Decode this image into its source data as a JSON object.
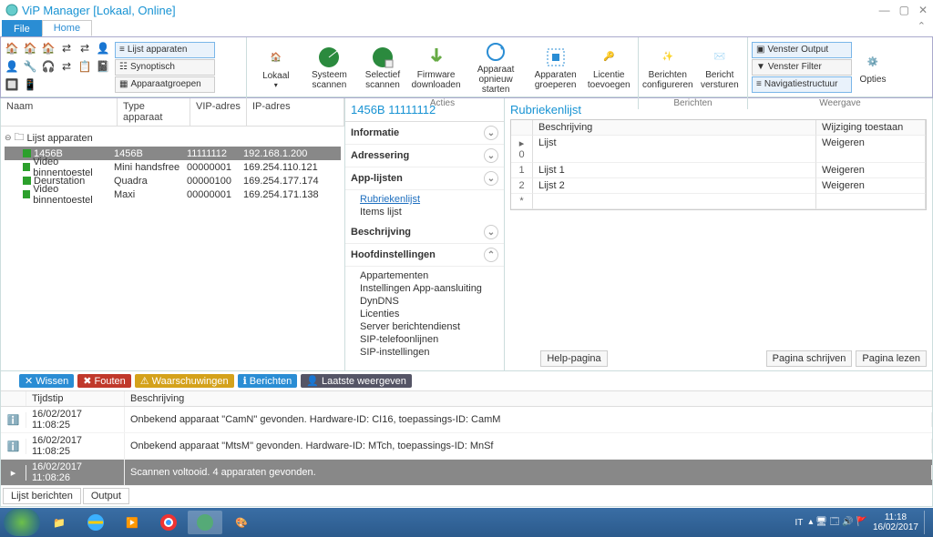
{
  "window": {
    "title": "ViP Manager [Lokaal, Online]"
  },
  "tabs": {
    "file": "File",
    "home": "Home"
  },
  "ribbon": {
    "list_group": {
      "list": "Lijst apparaten",
      "synoptisch": "Synoptisch",
      "groepen": "Apparaatgroepen"
    },
    "labels": {
      "nav": "Navigatiestructuur",
      "acties": "Acties",
      "berichten": "Berichten",
      "weergave": "Weergave"
    },
    "actions": {
      "lokaal": "Lokaal",
      "systeem": "Systeem\nscannen",
      "selectief": "Selectief\nscannen",
      "firmware": "Firmware\ndownloaden",
      "restart": "Apparaat\nopnieuw starten",
      "groep": "Apparaten\ngroeperen",
      "licentie": "Licentie\ntoevoegen"
    },
    "berichten": {
      "config": "Berichten\nconfigureren",
      "verst": "Bericht\nversturen"
    },
    "view": {
      "output": "Venster Output",
      "filter": "Venster Filter",
      "nav": "Navigatiestructuur",
      "opties": "Opties"
    }
  },
  "tree": {
    "cols": {
      "naam": "Naam",
      "type": "Type apparaat",
      "vip": "VIP-adres",
      "ip": "IP-adres"
    },
    "root": "Lijst apparaten",
    "rows": [
      {
        "naam": "1456B",
        "type": "1456B",
        "vip": "11111112",
        "ip": "192.168.1.200",
        "sel": true
      },
      {
        "naam": "Video binnentoestel",
        "type": "Mini handsfree",
        "vip": "00000001",
        "ip": "169.254.110.121"
      },
      {
        "naam": "Deurstation",
        "type": "Quadra",
        "vip": "00000100",
        "ip": "169.254.177.174"
      },
      {
        "naam": "Video binnentoestel",
        "type": "Maxi",
        "vip": "00000001",
        "ip": "169.254.171.138"
      }
    ]
  },
  "mid": {
    "title": "1456B 11111112",
    "sections": {
      "info": "Informatie",
      "addr": "Adressering",
      "app": "App-lijsten",
      "besch": "Beschrijving",
      "hoofd": "Hoofdinstellingen"
    },
    "app_items": {
      "rubriek": "Rubriekenlijst",
      "items": "Items lijst"
    },
    "hoofd_items": [
      "Appartementen",
      "Instellingen App-aansluiting",
      "DynDNS",
      "Licenties",
      "Server berichtendienst",
      "SIP-telefoonlijnen",
      "SIP-instellingen"
    ]
  },
  "right": {
    "title": "Rubriekenlijst",
    "head": {
      "besch": "Beschrijving",
      "wijz": "Wijziging toestaan"
    },
    "rows": [
      {
        "idx": "▸ 0",
        "b": "Lijst",
        "w": "Weigeren"
      },
      {
        "idx": "1",
        "b": "Lijst 1",
        "w": "Weigeren"
      },
      {
        "idx": "2",
        "b": "Lijst 2",
        "w": "Weigeren"
      },
      {
        "idx": "*",
        "b": "",
        "w": ""
      }
    ],
    "help": "Help-pagina",
    "schrijven": "Pagina schrijven",
    "lezen": "Pagina lezen"
  },
  "log": {
    "tabs": {
      "wissen": "Wissen",
      "fouten": "Fouten",
      "waarsch": "Waarschuwingen",
      "berichten": "Berichten",
      "laatste": "Laatste weergeven"
    },
    "head": {
      "tijd": "Tijdstip",
      "besch": "Beschrijving"
    },
    "rows": [
      {
        "t": "16/02/2017 11:08:25",
        "b": "Onbekend apparaat \"CamN\" gevonden. Hardware-ID: CI16, toepassings-ID: CamM"
      },
      {
        "t": "16/02/2017 11:08:25",
        "b": "Onbekend apparaat \"MtsM\" gevonden. Hardware-ID: MTch, toepassings-ID: MnSf"
      },
      {
        "t": "16/02/2017 11:08:26",
        "b": "Scannen voltooid. 4 apparaten gevonden.",
        "sel": true
      }
    ],
    "foot": {
      "lijst": "Lijst berichten",
      "output": "Output"
    }
  },
  "taskbar": {
    "lang": "IT",
    "time": "11:18",
    "date": "16/02/2017"
  }
}
